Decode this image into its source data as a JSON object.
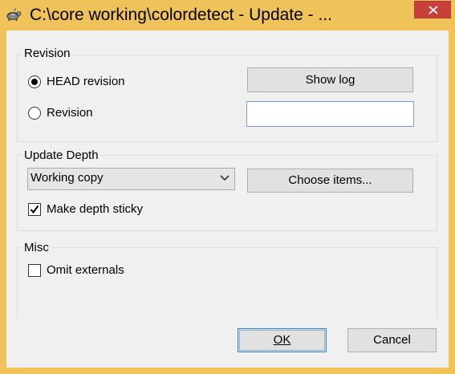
{
  "window": {
    "title": "C:\\core working\\colordetect - Update - ...",
    "app_icon": "tortoise-svn-icon",
    "close_icon": "close-icon"
  },
  "revision": {
    "group_label": "Revision",
    "head_label": "HEAD revision",
    "head_selected": true,
    "revision_label": "Revision",
    "revision_selected": false,
    "revision_value": "",
    "show_log_label": "Show log"
  },
  "depth": {
    "group_label": "Update Depth",
    "selected": "Working copy",
    "choose_items_label": "Choose items...",
    "sticky_label": "Make depth sticky",
    "sticky_checked": true
  },
  "misc": {
    "group_label": "Misc",
    "omit_externals_label": "Omit externals",
    "omit_externals_checked": false
  },
  "buttons": {
    "ok_label": "OK",
    "cancel_label": "Cancel"
  },
  "colors": {
    "title_bar": "#F0C25A",
    "close_button": "#C7403A",
    "dialog_bg": "#F0F0F0",
    "focus_border": "#3C7FB1"
  }
}
